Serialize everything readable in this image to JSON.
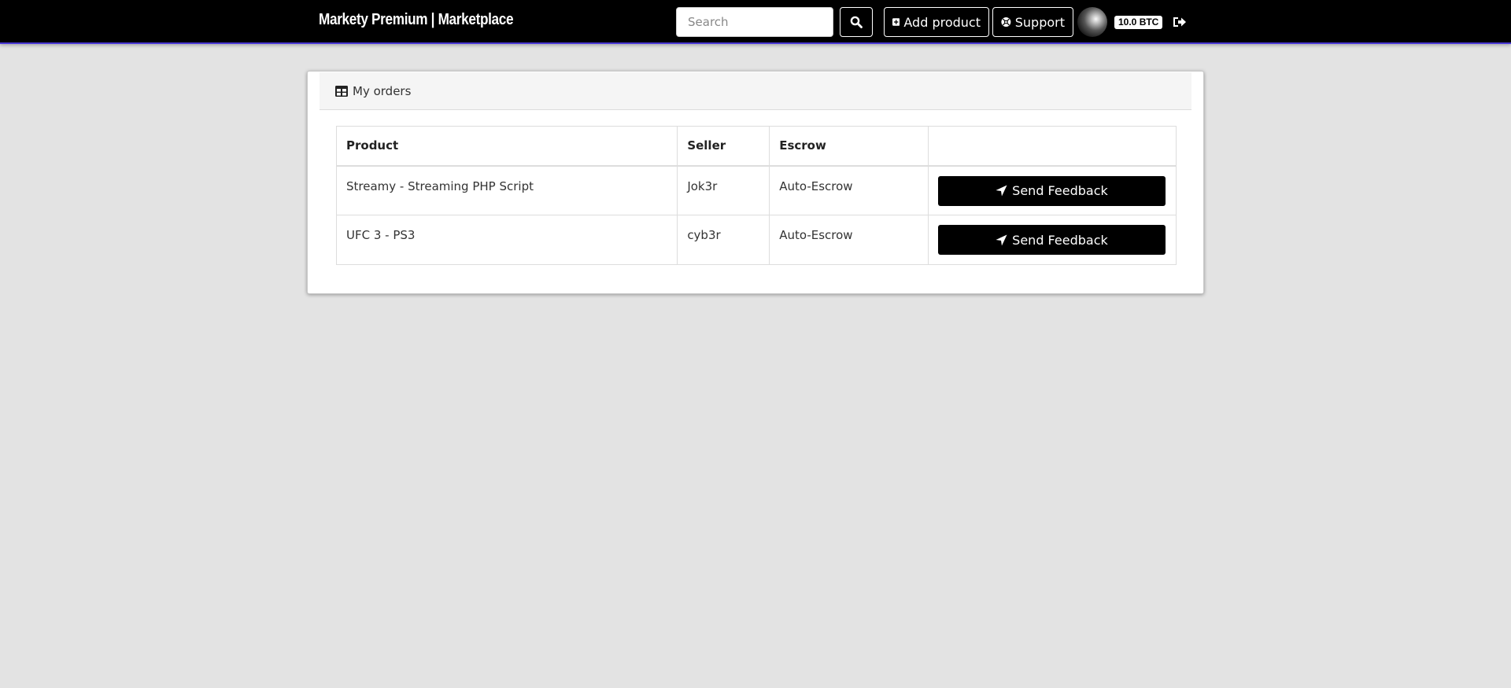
{
  "navbar": {
    "brand": "Markety Premium | Marketplace",
    "search_placeholder": "Search",
    "search_icon": "search-icon",
    "add_product_label": "Add product",
    "add_product_icon": "plus-square-icon",
    "support_label": "Support",
    "support_icon": "life-ring-icon",
    "balance": "10.0 BTC",
    "logout_icon": "sign-out-icon",
    "accent_color": "#4b3ad6"
  },
  "card": {
    "title": "My orders",
    "title_icon": "table-icon"
  },
  "orders": {
    "headers": [
      "Product",
      "Seller",
      "Escrow",
      ""
    ],
    "rows": [
      {
        "product": "Streamy - Streaming PHP Script",
        "seller": "Jok3r",
        "escrow": "Auto-Escrow",
        "action": "Send Feedback"
      },
      {
        "product": "UFC 3 - PS3",
        "seller": "cyb3r",
        "escrow": "Auto-Escrow",
        "action": "Send Feedback"
      }
    ],
    "action_icon": "paper-plane-icon"
  }
}
